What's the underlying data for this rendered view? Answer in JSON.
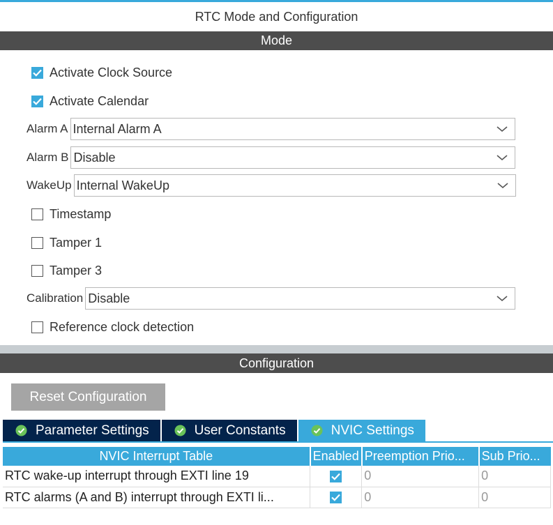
{
  "window": {
    "title": "RTC Mode and Configuration"
  },
  "mode": {
    "header": "Mode",
    "activate_clock_source": {
      "label": "Activate Clock Source",
      "checked": true
    },
    "activate_calendar": {
      "label": "Activate Calendar",
      "checked": true
    },
    "alarm_a": {
      "label": "Alarm A",
      "value": "Internal Alarm A"
    },
    "alarm_b": {
      "label": "Alarm B",
      "value": "Disable"
    },
    "wakeup": {
      "label": "WakeUp",
      "value": "Internal WakeUp"
    },
    "timestamp": {
      "label": "Timestamp",
      "checked": false
    },
    "tamper1": {
      "label": "Tamper 1",
      "checked": false
    },
    "tamper3": {
      "label": "Tamper 3",
      "checked": false
    },
    "calibration": {
      "label": "Calibration",
      "value": "Disable"
    },
    "reference_clock": {
      "label": "Reference clock detection",
      "checked": false
    }
  },
  "configuration": {
    "header": "Configuration",
    "reset_label": "Reset Configuration",
    "tabs": [
      {
        "label": "Parameter Settings",
        "active": false
      },
      {
        "label": "User Constants",
        "active": false
      },
      {
        "label": "NVIC Settings",
        "active": true
      }
    ],
    "nvic_table": {
      "columns": [
        "NVIC Interrupt Table",
        "Enabled",
        "Preemption Prio...",
        "Sub Prio..."
      ],
      "rows": [
        {
          "name": "RTC wake-up interrupt through EXTI line 19",
          "enabled": true,
          "preemption": "0",
          "sub": "0"
        },
        {
          "name": "RTC alarms (A and B) interrupt through EXTI li...",
          "enabled": true,
          "preemption": "0",
          "sub": "0"
        }
      ]
    }
  },
  "colors": {
    "accent": "#39a9db",
    "section_bar": "#4d4d4d",
    "tab_dark": "#03234b",
    "button_gray": "#a5a5a5"
  }
}
